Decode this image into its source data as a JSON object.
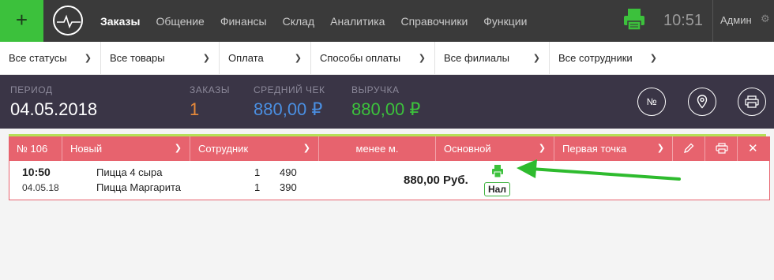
{
  "topbar": {
    "add_label": "+",
    "nav": [
      "Заказы",
      "Общение",
      "Финансы",
      "Склад",
      "Аналитика",
      "Справочники",
      "Функции"
    ],
    "clock": "10:51",
    "user": "Админ"
  },
  "filters": [
    "Все статусы",
    "Все товары",
    "Оплата",
    "Способы оплаты",
    "Все филиалы",
    "Все сотрудники"
  ],
  "stats": {
    "period_label": "ПЕРИОД",
    "period_value": "04.05.2018",
    "orders_label": "ЗАКАЗЫ",
    "orders_value": "1",
    "avg_label": "СРЕДНИЙ ЧЕК",
    "avg_value": "880,00 ₽",
    "revenue_label": "ВЫРУЧКА",
    "revenue_value": "880,00 ₽",
    "number_btn": "№"
  },
  "order": {
    "number": "№ 106",
    "status": "Новый",
    "employee": "Сотрудник",
    "time_left": "менее м.",
    "type": "Основной",
    "point": "Первая точка",
    "time": "10:50",
    "date": "04.05.18",
    "items": [
      {
        "name": "Пицца 4 сыра",
        "qty": "1",
        "price": "490"
      },
      {
        "name": "Пицца Маргарита",
        "qty": "1",
        "price": "390"
      }
    ],
    "total": "880,00 Руб.",
    "payment": "Нал"
  },
  "colors": {
    "accent_green": "#3cc13c",
    "order_red": "#e7636e",
    "avg_blue": "#4a8ee0",
    "orders_orange": "#e88a3a",
    "revenue_green": "#3cc13c"
  }
}
